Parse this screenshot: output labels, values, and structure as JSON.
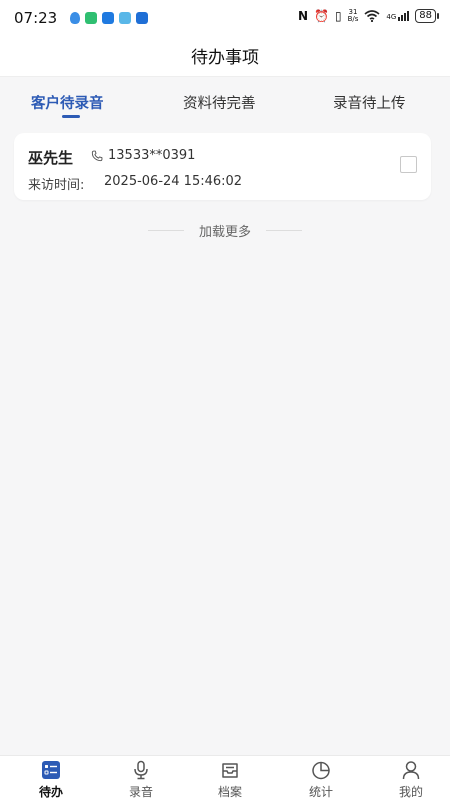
{
  "status_bar": {
    "time": "07:23",
    "network_speed_value": "31",
    "network_speed_unit": "B/s",
    "signal_type": "4G",
    "battery": "88",
    "app_icon_colors": [
      "#3a8ee6",
      "#2fbf71",
      "#1f7ae0",
      "#59b7e8",
      "#1f6fd6"
    ]
  },
  "header": {
    "title": "待办事项"
  },
  "tabs": [
    {
      "label": "客户待录音",
      "active": true
    },
    {
      "label": "资料待完善",
      "active": false
    },
    {
      "label": "录音待上传",
      "active": false
    }
  ],
  "list": {
    "items": [
      {
        "name": "巫先生",
        "phone": "13533**0391",
        "visit_label": "来访时间:",
        "visit_time": "2025-06-24 15:46:02",
        "checked": false
      }
    ],
    "load_more": "加载更多"
  },
  "bottom_nav": {
    "items": [
      {
        "label": "待办",
        "icon": "todo-list-icon",
        "active": true
      },
      {
        "label": "录音",
        "icon": "microphone-icon",
        "active": false
      },
      {
        "label": "档案",
        "icon": "archive-icon",
        "active": false
      },
      {
        "label": "统计",
        "icon": "pie-chart-icon",
        "active": false
      },
      {
        "label": "我的",
        "icon": "user-icon",
        "active": false
      }
    ]
  },
  "colors": {
    "accent": "#2d5bb5",
    "background": "#f6f6f7"
  }
}
